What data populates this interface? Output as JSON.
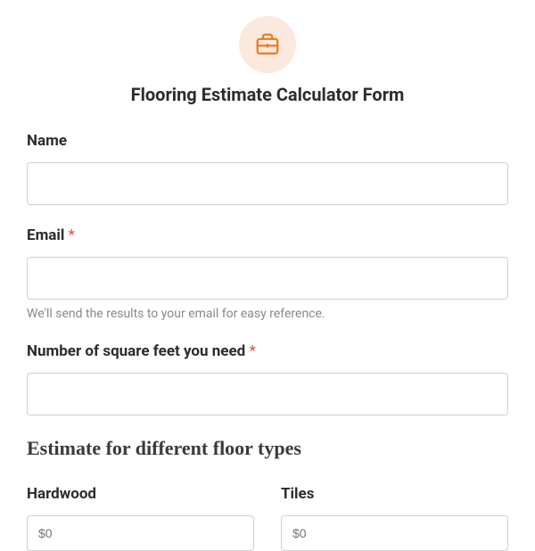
{
  "header": {
    "title": "Flooring Estimate Calculator Form"
  },
  "fields": {
    "name": {
      "label": "Name",
      "required": false,
      "value": ""
    },
    "email": {
      "label": "Email",
      "required": true,
      "value": "",
      "help": "We'll send the results to your email for easy reference."
    },
    "sqft": {
      "label": "Number of square feet you need",
      "required": true,
      "value": ""
    }
  },
  "section": {
    "heading": "Estimate for different floor types"
  },
  "estimates": {
    "hardwood": {
      "label": "Hardwood",
      "placeholder": "$0"
    },
    "tiles": {
      "label": "Tiles",
      "placeholder": "$0"
    }
  },
  "required_marker": "*"
}
